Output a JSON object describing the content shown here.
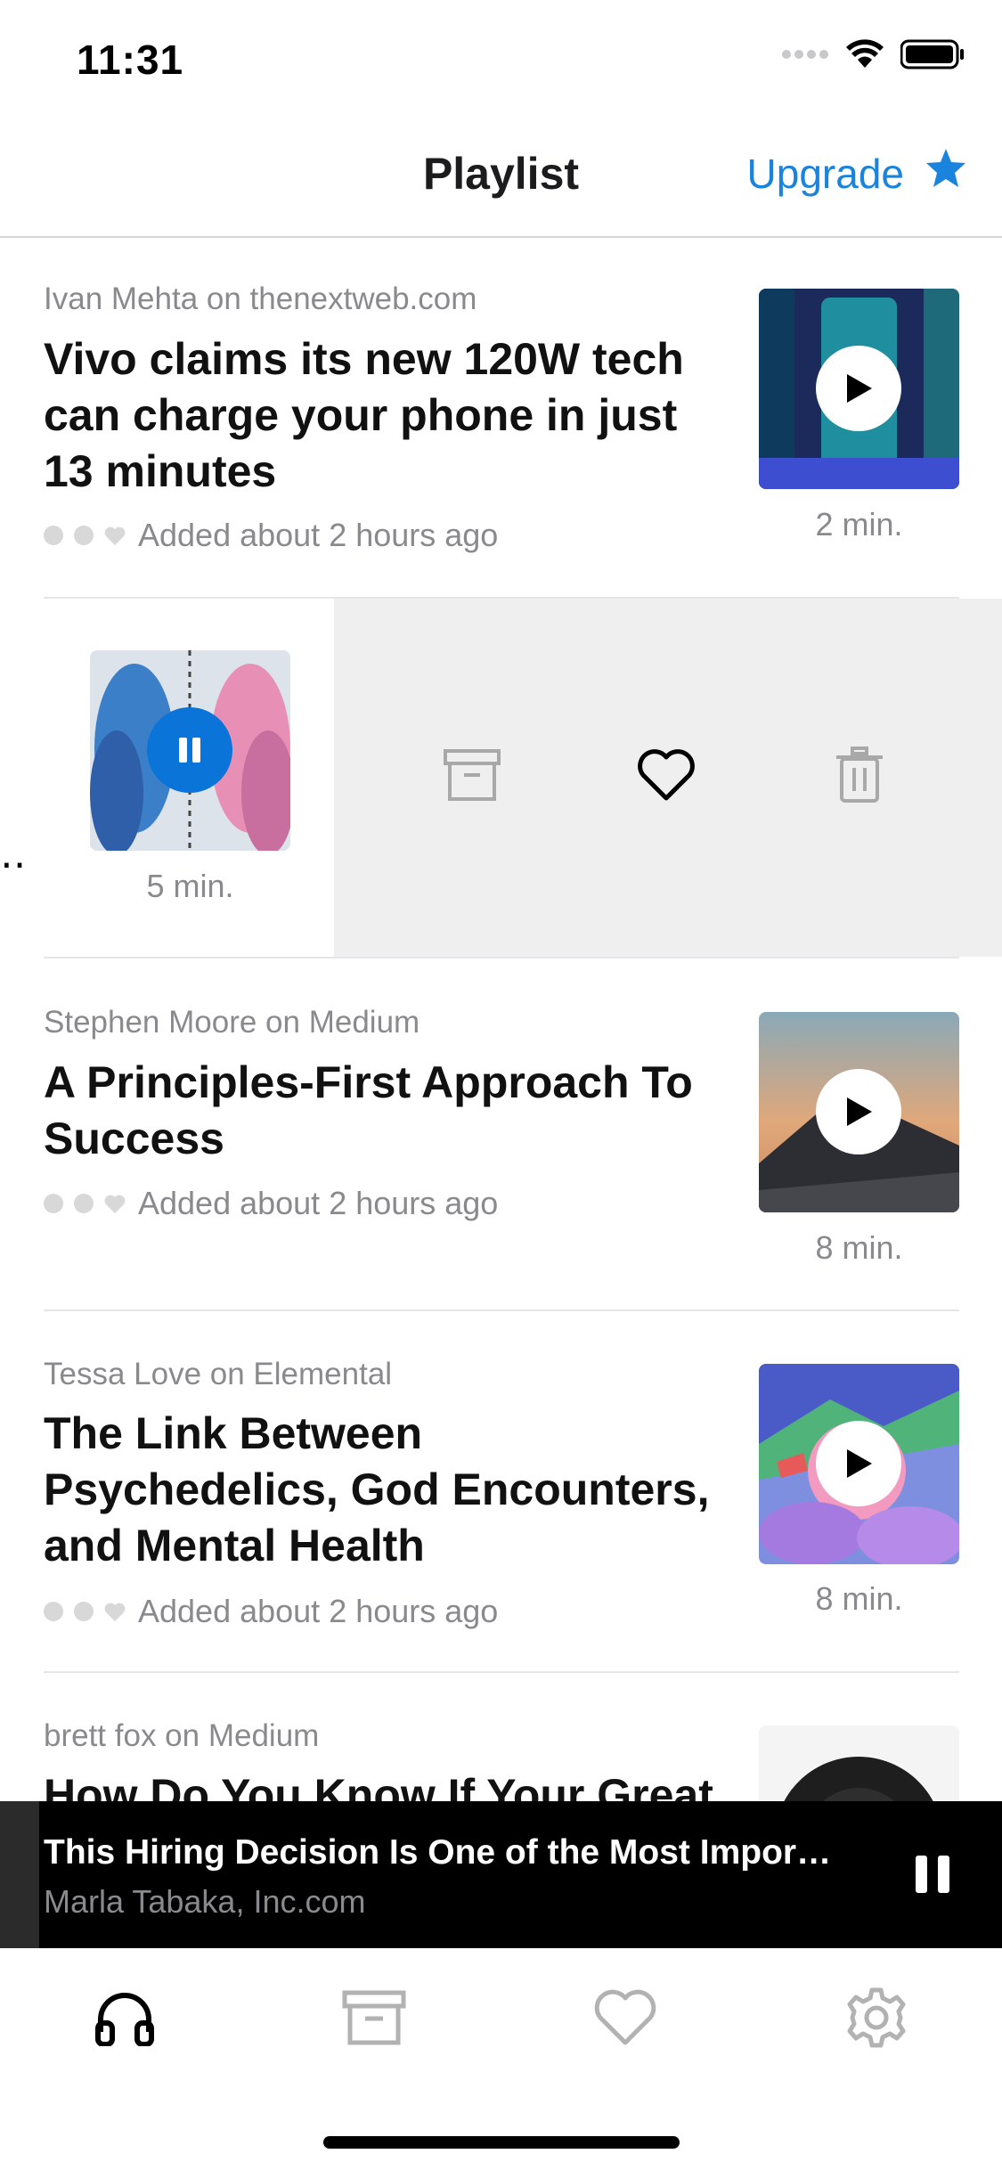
{
  "status_bar": {
    "time": "11:31"
  },
  "nav": {
    "title": "Playlist",
    "upgrade_label": "Upgrade"
  },
  "articles": [
    {
      "source": "Ivan Mehta on thenextweb.com",
      "title": "Vivo claims its new 120W tech can charge your phone in just 13 minutes",
      "added": "Added about 2 hours ago",
      "duration": "2 min."
    },
    {
      "duration": "5 min.",
      "swiped": true
    },
    {
      "source": "Stephen Moore on Medium",
      "title": "A Principles-First Approach To Success",
      "added": "Added about 2 hours ago",
      "duration": "8 min."
    },
    {
      "source": "Tessa Love on Elemental",
      "title": "The Link Between Psychedelics, God Encounters, and Mental Health",
      "added": "Added about 2 hours ago",
      "duration": "8 min."
    },
    {
      "source": "brett fox on Medium",
      "title": "How Do You Know If Your Great"
    }
  ],
  "swipe_actions": [
    "archive-icon",
    "heart-icon",
    "trash-icon"
  ],
  "mini_player": {
    "title": "This Hiring Decision Is One of the Most Impor…",
    "subtitle": "Marla Tabaka, Inc.com"
  },
  "tabs": [
    "headphones-icon",
    "archive-icon",
    "heart-icon",
    "gear-icon"
  ],
  "colors": {
    "accent": "#1a83dd",
    "active_play": "#0a74d9"
  }
}
